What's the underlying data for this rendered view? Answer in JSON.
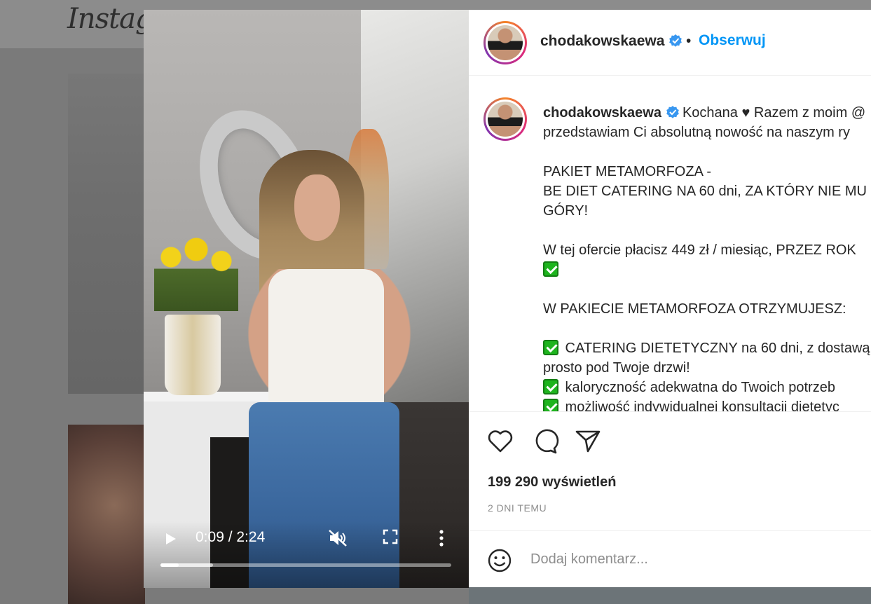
{
  "background": {
    "logo": "Instagr"
  },
  "video": {
    "current_time": "0:09",
    "duration": "2:24",
    "time_display": "0:09 / 2:24",
    "progress_fraction": 0.0625,
    "buffered_fraction": 0.18,
    "muted": true
  },
  "post": {
    "username": "chodakowskaewa",
    "verified": true,
    "separator": "•",
    "follow_label": "Obserwuj",
    "caption_lines": [
      "Kochana ♥ Razem z moim @",
      "przedstawiam Ci absolutną nowość na naszym ry",
      "",
      "PAKIET METAMORFOZA -",
      "BE DIET CATERING NA 60 dni, ZA KTÓRY NIE MU",
      "GÓRY!",
      "",
      "W tej ofercie płacisz 449 zł / miesiąc, PRZEZ ROK",
      "[check]",
      "",
      "W PAKIECIE METAMORFOZA OTRZYMUJESZ:",
      "",
      "[check] CATERING DIETETYCZNY na 60 dni, z dostawą",
      "prosto pod Twoje drzwi!",
      "[check] kaloryczność adekwatna do Twoich potrzeb",
      "[check] możliwość indywidualnej konsultacji dietetyc"
    ],
    "views": "199 290 wyświetleń",
    "date": "2 DNI TEMU",
    "comment_placeholder": "Dodaj komentarz..."
  },
  "colors": {
    "accent": "#0095f6",
    "verified": "#3897f0",
    "check": "#1eb41e"
  }
}
